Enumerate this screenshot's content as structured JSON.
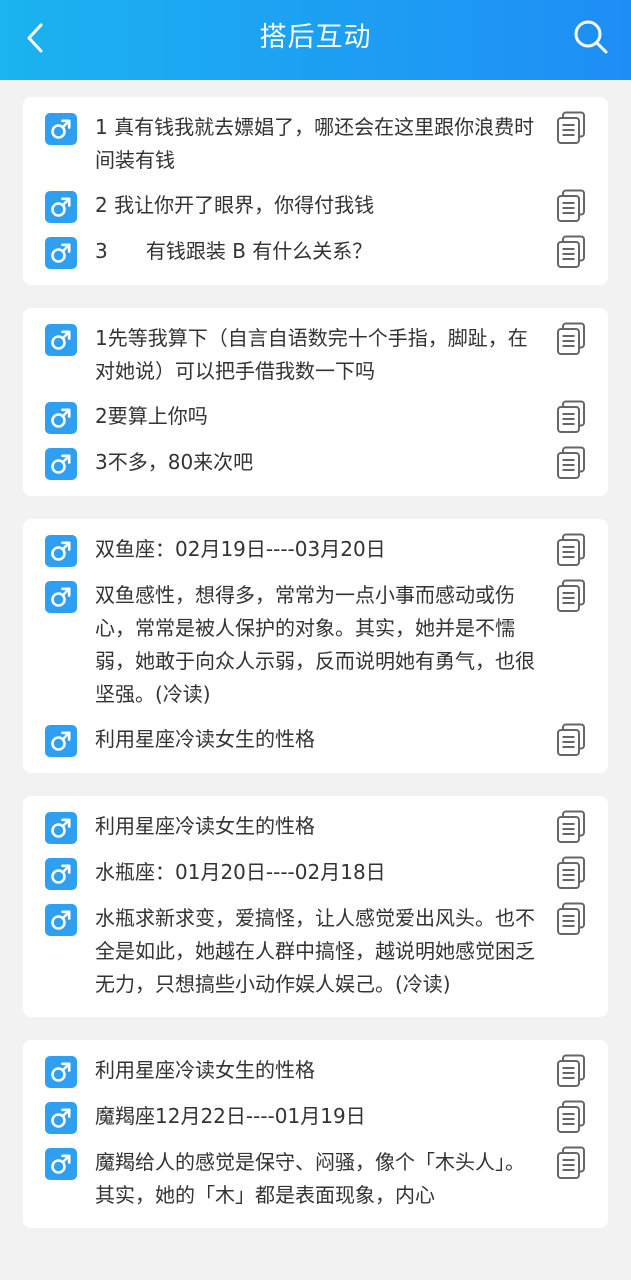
{
  "header": {
    "title": "搭后互动"
  },
  "icons": {
    "back": "chevron-left-icon",
    "search": "search-icon",
    "gender": "male-icon",
    "copy": "copy-icon"
  },
  "colors": {
    "header_start": "#1bb3f0",
    "header_end": "#1e8ef5",
    "male_badge": "#2f9ff2",
    "copy_icon": "#666666"
  },
  "cards": [
    {
      "items": [
        {
          "text": "1  真有钱我就去嫖娼了，哪还会在这里跟你浪费时间装有钱"
        },
        {
          "text": "2  我让你开了眼界，你得付我钱"
        },
        {
          "text": "3      有钱跟装 B 有什么关系？"
        }
      ]
    },
    {
      "items": [
        {
          "text": "1先等我算下（自言自语数完十个手指，脚趾，在对她说）可以把手借我数一下吗"
        },
        {
          "text": "2要算上你吗"
        },
        {
          "text": "3不多，80来次吧"
        }
      ]
    },
    {
      "items": [
        {
          "text": "双鱼座：02月19日----03月20日"
        },
        {
          "text": "双鱼感性，想得多，常常为一点小事而感动或伤心，常常是被人保护的对象。其实，她并是不懦弱，她敢于向众人示弱，反而说明她有勇气，也很坚强。(冷读)"
        },
        {
          "text": "利用星座冷读女生的性格"
        }
      ]
    },
    {
      "items": [
        {
          "text": "利用星座冷读女生的性格"
        },
        {
          "text": "水瓶座：01月20日----02月18日"
        },
        {
          "text": "水瓶求新求变，爱搞怪，让人感觉爱出风头。也不全是如此，她越在人群中搞怪，越说明她感觉困乏无力，只想搞些小动作娱人娱己。(冷读)"
        }
      ]
    },
    {
      "items": [
        {
          "text": "利用星座冷读女生的性格"
        },
        {
          "text": "魔羯座12月22日----01月19日"
        },
        {
          "text": "魔羯给人的感觉是保守、闷骚，像个「木头人」。其实，她的「木」都是表面现象，内心"
        }
      ]
    }
  ]
}
